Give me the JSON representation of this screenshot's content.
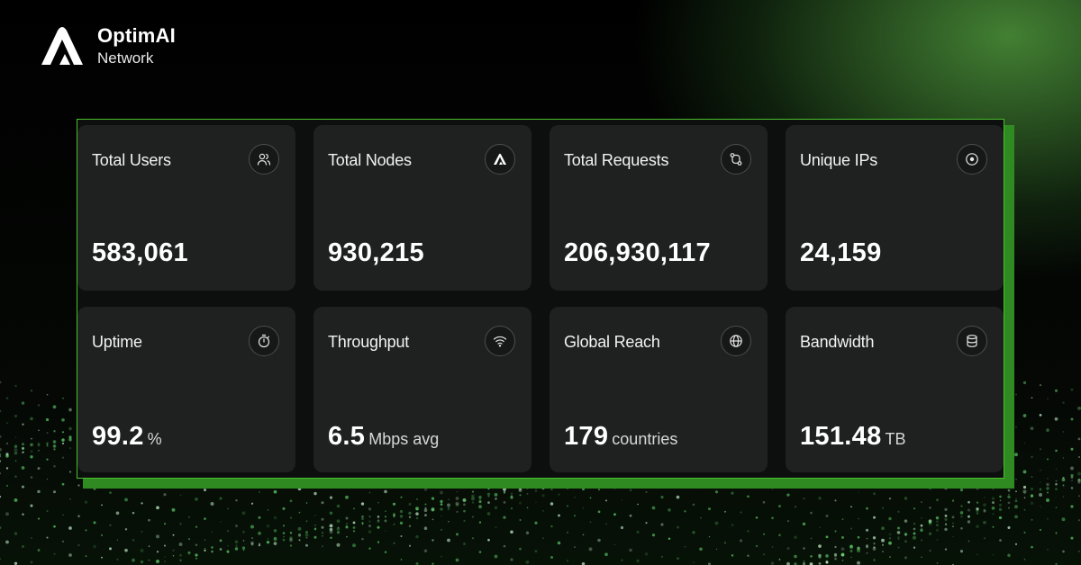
{
  "brand": {
    "name": "OptimAI",
    "sub": "Network"
  },
  "stats": [
    {
      "title": "Total Users",
      "value": "583,061",
      "unit": "",
      "icon": "users-icon"
    },
    {
      "title": "Total Nodes",
      "value": "930,215",
      "unit": "",
      "icon": "optimai-logo-icon"
    },
    {
      "title": "Total Requests",
      "value": "206,930,117",
      "unit": "",
      "icon": "git-pull-request-icon"
    },
    {
      "title": "Unique IPs",
      "value": "24,159",
      "unit": "",
      "icon": "target-circle-icon"
    },
    {
      "title": "Uptime",
      "value": "99.2",
      "unit": "%",
      "icon": "stopwatch-icon"
    },
    {
      "title": "Throughput",
      "value": "6.5",
      "unit": "Mbps avg",
      "icon": "wifi-icon"
    },
    {
      "title": "Global Reach",
      "value": "179",
      "unit": "countries",
      "icon": "globe-icon"
    },
    {
      "title": "Bandwidth",
      "value": "151.48",
      "unit": "TB",
      "icon": "database-icon"
    }
  ],
  "colors": {
    "accent": "#4bbf2e",
    "card": "#1e2120",
    "panel": "#0d0f0e"
  }
}
